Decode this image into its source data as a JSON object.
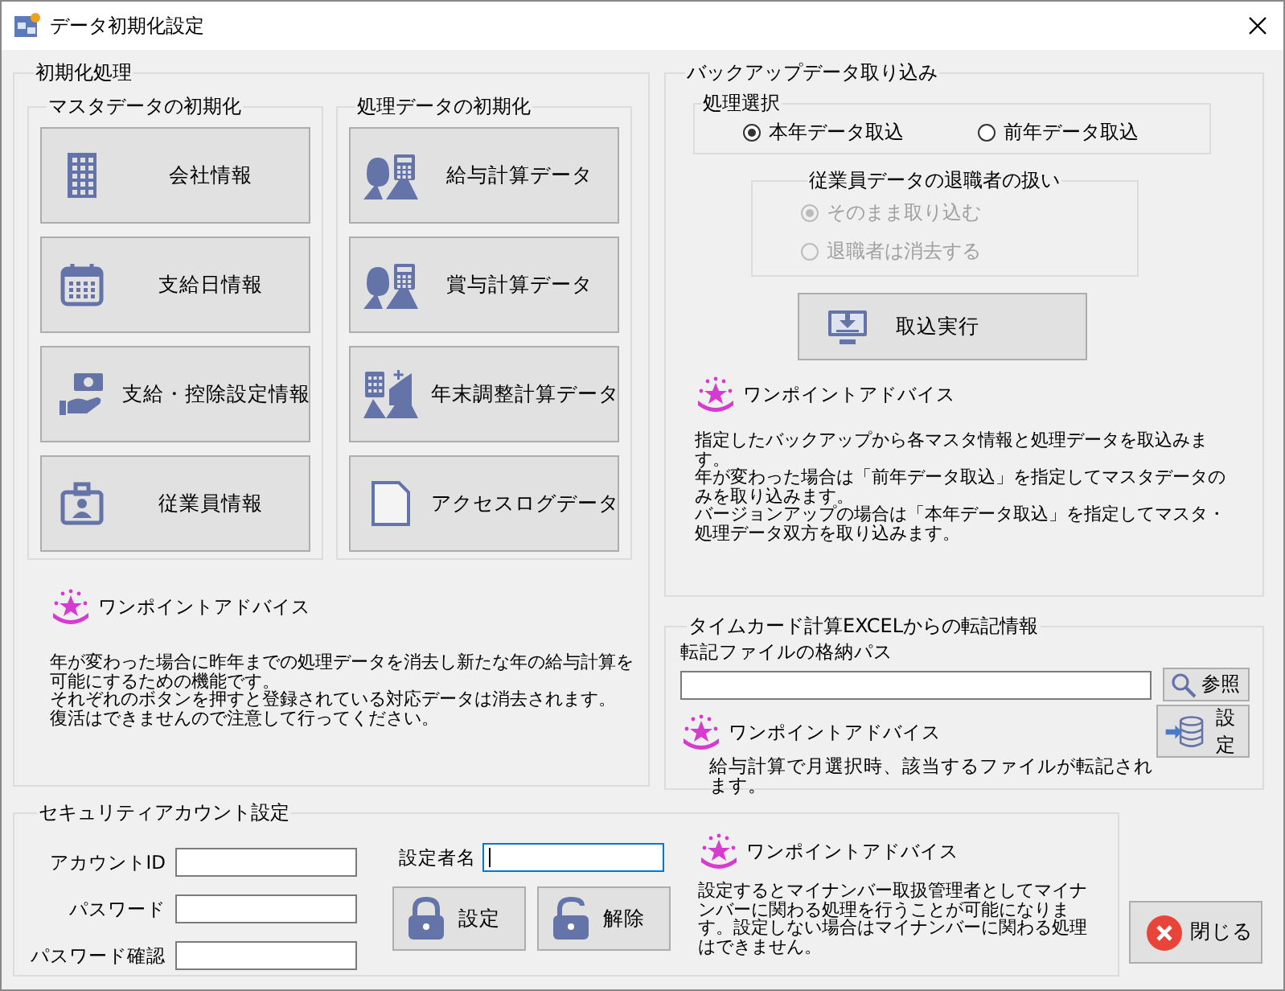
{
  "window": {
    "title": "データ初期化設定"
  },
  "init_group": {
    "title": "初期化処理",
    "master": {
      "title": "マスタデータの初期化",
      "buttons": [
        {
          "label": "会社情報",
          "kind": "building"
        },
        {
          "label": "支給日情報",
          "kind": "calendar"
        },
        {
          "label": "支給・控除設定情報",
          "kind": "hand"
        },
        {
          "label": "従業員情報",
          "kind": "badge"
        }
      ]
    },
    "processing": {
      "title": "処理データの初期化",
      "buttons": [
        {
          "label": "給与計算データ",
          "kind": "bags"
        },
        {
          "label": "賞与計算データ",
          "kind": "bags"
        },
        {
          "label": "年末調整計算データ",
          "kind": "calcbags"
        },
        {
          "label": "アクセスログデータ",
          "kind": "log"
        }
      ]
    },
    "advice": {
      "title": "ワンポイントアドバイス",
      "paragraphs": [
        "年が変わった場合に昨年までの処理データを消去し新たな年の給与計算を可能にするための機能です。",
        "それぞれのボタンを押すと登録されている対応データは消去されます。",
        "復活はできませんので注意して行ってください。"
      ]
    }
  },
  "backup": {
    "title": "バックアップデータ取り込み",
    "mode": {
      "title": "処理選択",
      "options": [
        {
          "label": "本年データ取込",
          "selected": true
        },
        {
          "label": "前年データ取込",
          "selected": false
        }
      ]
    },
    "retirees": {
      "title": "従業員データの退職者の扱い",
      "disabled": true,
      "options": [
        {
          "label": "そのまま取り込む",
          "selected": true
        },
        {
          "label": "退職者は消去する",
          "selected": false
        }
      ]
    },
    "run_button": "取込実行",
    "advice": {
      "title": "ワンポイントアドバイス",
      "paragraphs": [
        "指定したバックアップから各マスタ情報と処理データを取込みます。",
        "年が変わった場合は「前年データ取込」を指定してマスタデータのみを取り込みます。",
        "バージョンアップの場合は「本年データ取込」を指定してマスタ・処理データ双方を取り込みます。"
      ]
    }
  },
  "timecard": {
    "title": "タイムカード計算EXCELからの転記情報",
    "path_label": "転記ファイルの格納パス",
    "browse_button": "参照",
    "set_button": "設定",
    "advice": {
      "title": "ワンポイントアドバイス",
      "paragraphs": [
        "給与計算で月選択時、該当するファイルが転記されます。"
      ]
    }
  },
  "security": {
    "title": "セキュリティアカウント設定",
    "fields": [
      {
        "label": "アカウントID"
      },
      {
        "label": "パスワード"
      },
      {
        "label": "パスワード確認"
      }
    ],
    "setter": {
      "label": "設定者名",
      "focused": true
    },
    "buttons": [
      {
        "label": "設定",
        "kind": "locked"
      },
      {
        "label": "解除",
        "kind": "unlocked"
      }
    ],
    "advice": {
      "title": "ワンポイントアドバイス",
      "paragraphs": [
        "設定するとマイナンバー取扱管理者としてマイナンバーに関わる処理を行うことが可能になります。設定しない場合はマイナンバーに関わる処理はできません。"
      ]
    }
  },
  "close_button": "閉じる"
}
